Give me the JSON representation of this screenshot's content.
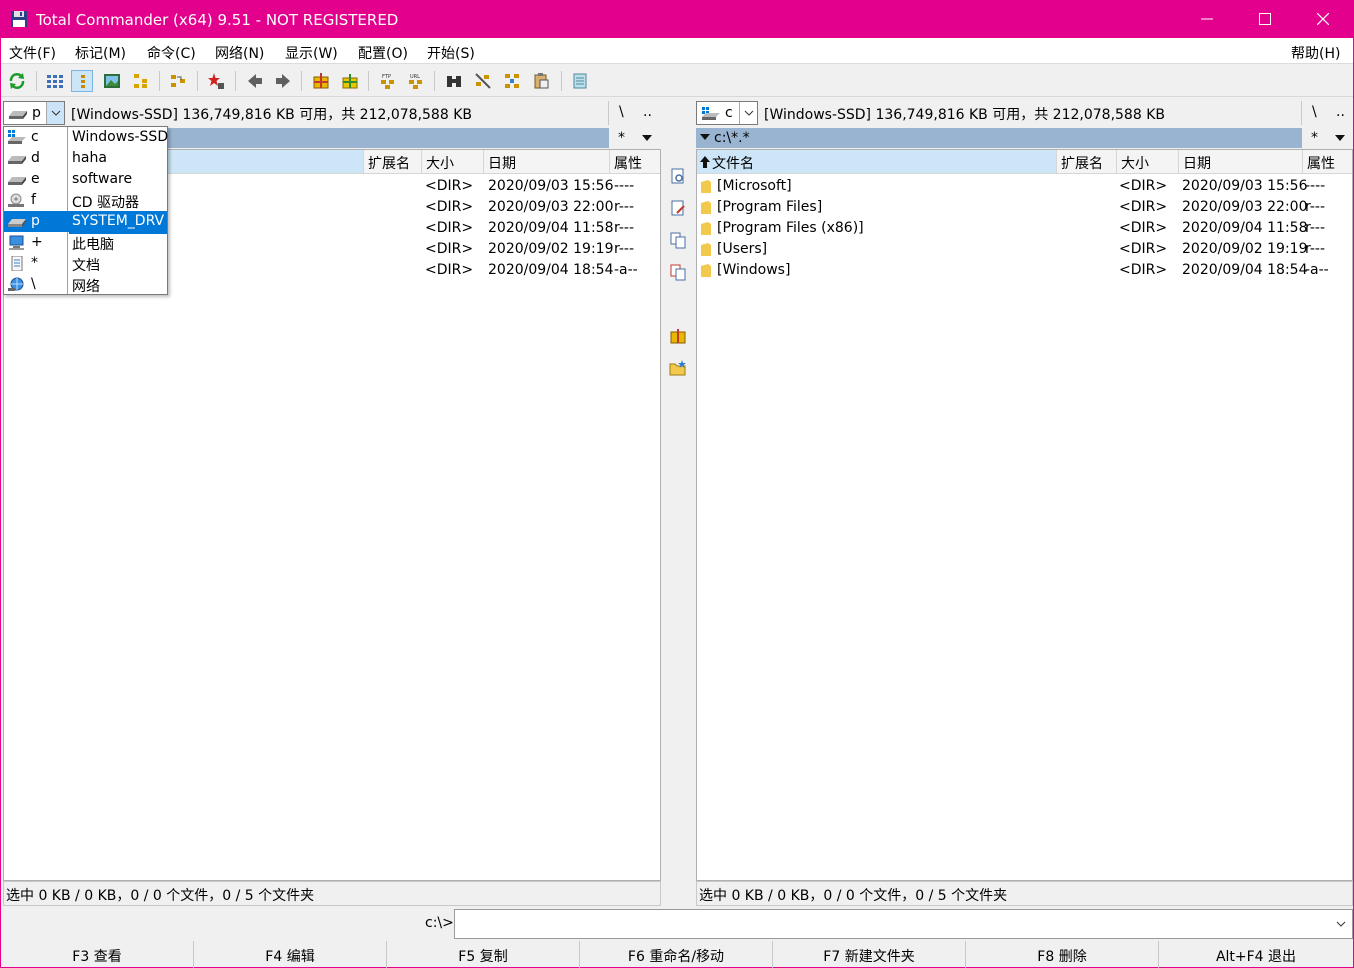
{
  "window": {
    "title": "Total Commander (x64) 9.51 - NOT REGISTERED",
    "accent": "#e3008c"
  },
  "menu": {
    "items": [
      "文件(F)",
      "标记(M)",
      "命令(C)",
      "网络(N)",
      "显示(W)",
      "配置(O)",
      "开始(S)"
    ],
    "help": "帮助(H)"
  },
  "left": {
    "drive": "p",
    "drive_info": "[Windows-SSD]  136,749,816 KB 可用，共 212,078,588 KB",
    "root": "\\",
    "up": "..",
    "filter": "*",
    "columns": {
      "ext": "扩展名",
      "size": "大小",
      "date": "日期",
      "attr": "属性"
    },
    "rows": [
      {
        "size": "<DIR>",
        "date": "2020/09/03 15:56",
        "attr": "----"
      },
      {
        "size": "<DIR>",
        "date": "2020/09/03 22:00",
        "attr": "r---"
      },
      {
        "size": "<DIR>",
        "date": "2020/09/04 11:58",
        "attr": "r---"
      },
      {
        "size": "<DIR>",
        "date": "2020/09/02 19:19",
        "attr": "r---"
      },
      {
        "size": "<DIR>",
        "date": "2020/09/04 18:54",
        "attr": "-a--"
      }
    ],
    "status": "选中 0 KB / 0 KB，0 / 0 个文件，0 / 5 个文件夹"
  },
  "right": {
    "drive": "c",
    "drive_info": "[Windows-SSD]  136,749,816 KB 可用，共 212,078,588 KB",
    "root": "\\",
    "up": "..",
    "path": "c:\\*.*",
    "filter": "*",
    "columns": {
      "name": "文件名",
      "ext": "扩展名",
      "size": "大小",
      "date": "日期",
      "attr": "属性"
    },
    "rows": [
      {
        "name": "[Microsoft]",
        "size": "<DIR>",
        "date": "2020/09/03 15:56",
        "attr": "----"
      },
      {
        "name": "[Program Files]",
        "size": "<DIR>",
        "date": "2020/09/03 22:00",
        "attr": "r---"
      },
      {
        "name": "[Program Files (x86)]",
        "size": "<DIR>",
        "date": "2020/09/04 11:58",
        "attr": "r---"
      },
      {
        "name": "[Users]",
        "size": "<DIR>",
        "date": "2020/09/02 19:19",
        "attr": "r---"
      },
      {
        "name": "[Windows]",
        "size": "<DIR>",
        "date": "2020/09/04 18:54",
        "attr": "-a--"
      }
    ],
    "status": "选中 0 KB / 0 KB，0 / 0 个文件，0 / 5 个文件夹"
  },
  "drive_list": [
    {
      "letter": "c",
      "name": "Windows-SSD",
      "icon": "windows-drive-icon"
    },
    {
      "letter": "d",
      "name": "haha",
      "icon": "hard-drive-icon"
    },
    {
      "letter": "e",
      "name": "software",
      "icon": "hard-drive-icon"
    },
    {
      "letter": "f",
      "name": "CD 驱动器",
      "icon": "cd-drive-icon"
    },
    {
      "letter": "p",
      "name": "SYSTEM_DRV",
      "icon": "hard-drive-icon",
      "selected": true
    },
    {
      "letter": "+",
      "name": "此电脑",
      "icon": "computer-icon"
    },
    {
      "letter": "*",
      "name": "文档",
      "icon": "document-icon"
    },
    {
      "letter": "\\",
      "name": "网络",
      "icon": "network-icon"
    }
  ],
  "command": {
    "prompt": "c:\\>",
    "value": ""
  },
  "fkeys": [
    "F3 查看",
    "F4 编辑",
    "F5 复制",
    "F6 重命名/移动",
    "F7 新建文件夹",
    "F8 删除",
    "Alt+F4 退出"
  ]
}
